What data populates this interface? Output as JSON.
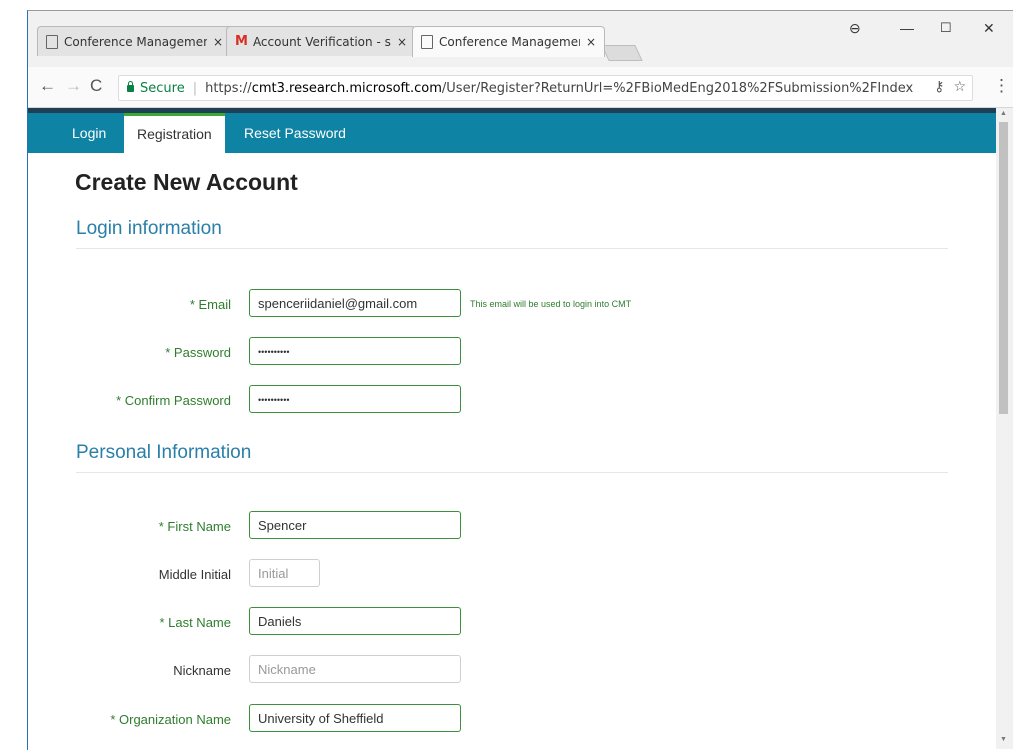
{
  "browser": {
    "tabs": [
      {
        "label": "Conference Management",
        "icon": "page-icon"
      },
      {
        "label": "Account Verification - sp",
        "icon": "gmail-icon"
      },
      {
        "label": "Conference Management",
        "icon": "page-icon"
      }
    ],
    "tab_close": "×",
    "secure_label": "Secure",
    "url_domain": "cmt3.research.microsoft.com",
    "url_prefix": "https://",
    "url_path": "/User/Register?ReturnUrl=%2FBioMedEng2018%2FSubmission%2FIndex",
    "icons": [
      "back-icon",
      "forward-icon",
      "reload-icon",
      "lock-icon",
      "key-icon",
      "star-icon",
      "menu-icon",
      "profile-icon",
      "minimize-icon",
      "maximize-icon",
      "close-icon"
    ]
  },
  "nav": {
    "items": [
      "Login",
      "Registration",
      "Reset Password"
    ],
    "active": "Registration"
  },
  "page_title": "Create New Account",
  "login_section": {
    "title": "Login information",
    "email_label": "* Email",
    "email_value": "spenceriidaniel@gmail.com",
    "email_hint": "This email will be used to login into CMT",
    "password_label": "* Password",
    "password_value": "••••••••••",
    "confirm_label": "* Confirm Password",
    "confirm_value": "••••••••••"
  },
  "personal_section": {
    "title": "Personal Information",
    "first_name_label": "* First Name",
    "first_name_value": "Spencer",
    "middle_label": "Middle Initial",
    "middle_placeholder": "Initial",
    "last_name_label": "* Last Name",
    "last_name_value": "Daniels",
    "nickname_label": "Nickname",
    "nickname_placeholder": "Nickname",
    "org_label": "* Organization Name",
    "org_value": "University of Sheffield"
  },
  "colors": {
    "nav_bg": "#0f83a3",
    "required_green": "#2f7d2f",
    "section_blue": "#2a7fa9"
  }
}
